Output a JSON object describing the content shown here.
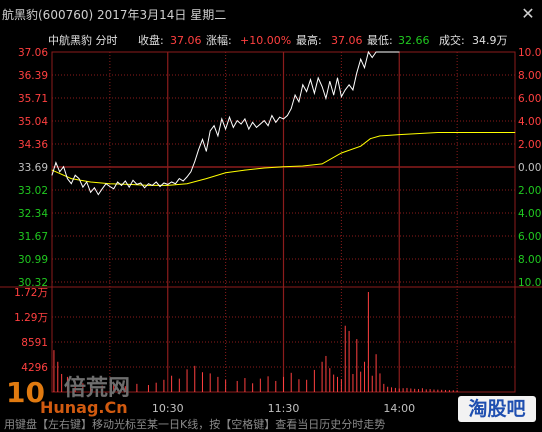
{
  "window": {
    "title": "航黑豹(600760) 2017年3月14日 星期二",
    "close_icon": "close-icon"
  },
  "header": {
    "name": "中航黑豹",
    "mode": "分时",
    "close_label": "收盘:",
    "close_value": "37.06",
    "change_label": "涨幅:",
    "change_value": "+10.00%",
    "high_label": "最高:",
    "high_value": "37.06",
    "low_label": "最低:",
    "low_value": "32.66",
    "volume_label": "成交:",
    "volume_value": "34.9万"
  },
  "colors": {
    "up": "#ff4040",
    "down": "#20c820",
    "avg": "#ffff00",
    "price_line": "#ffffff",
    "grid": "#8c1c1c",
    "volume_bar": "#ff4040",
    "text_gray": "#c0c0c0"
  },
  "chart_data": {
    "type": "line",
    "price_axis": {
      "ticks": [
        "37.06",
        "36.39",
        "35.71",
        "35.04",
        "34.36",
        "33.69",
        "33.02",
        "32.34",
        "31.67",
        "30.99",
        "30.32"
      ],
      "ylim": [
        30.32,
        37.06
      ],
      "prev_close": 33.69
    },
    "pct_axis": {
      "ticks": [
        "10.00",
        "8.00",
        "6.00",
        "4.00",
        "2.00",
        "0.00",
        "2.00",
        "4.00",
        "6.00",
        "8.00",
        "10.0"
      ]
    },
    "x_axis": {
      "labels": [
        "10:30",
        "11:30",
        "14:00"
      ],
      "label_minutes": [
        60,
        120,
        180
      ],
      "total_minutes": 240
    },
    "series": [
      {
        "name": "",
        "minutes": [
          0,
          2,
          4,
          6,
          8,
          10,
          12,
          14,
          16,
          18,
          20,
          22,
          24,
          26,
          28,
          30,
          32,
          34,
          36,
          38,
          40,
          42,
          44,
          46,
          48,
          50,
          52,
          54,
          56,
          58,
          60,
          62,
          64,
          66,
          68,
          70,
          72,
          74,
          76,
          78,
          80,
          82,
          84,
          86,
          88,
          90,
          92,
          94,
          96,
          98,
          100,
          102,
          104,
          106,
          108,
          110,
          112,
          114,
          116,
          118,
          120,
          122,
          124,
          126,
          128,
          130,
          132,
          134,
          136,
          138,
          140,
          142,
          144,
          146,
          148,
          150,
          152,
          154,
          156,
          158,
          160,
          162,
          164,
          166,
          168,
          170,
          172,
          174,
          176,
          178,
          180
        ],
        "values": [
          33.45,
          33.82,
          33.55,
          33.7,
          33.35,
          33.2,
          33.45,
          33.35,
          33.1,
          33.25,
          32.95,
          33.08,
          32.88,
          33.05,
          33.2,
          33.12,
          33.05,
          33.25,
          33.15,
          33.28,
          33.1,
          33.3,
          33.18,
          33.22,
          33.08,
          33.2,
          33.15,
          33.25,
          33.12,
          33.22,
          33.18,
          33.25,
          33.2,
          33.35,
          33.28,
          33.4,
          33.55,
          33.85,
          34.2,
          34.5,
          34.15,
          34.75,
          34.9,
          34.6,
          35.1,
          34.8,
          35.15,
          34.85,
          35.05,
          34.95,
          35.1,
          34.8,
          35.0,
          34.85,
          34.95,
          35.05,
          34.9,
          35.2,
          35.0,
          35.15,
          35.1,
          35.2,
          35.4,
          35.8,
          35.6,
          36.1,
          35.9,
          36.25,
          35.85,
          36.3,
          36.05,
          35.7,
          36.2,
          35.8,
          36.3,
          35.75,
          35.95,
          36.1,
          35.95,
          36.45,
          36.85,
          36.6,
          37.06,
          36.9,
          37.06,
          37.06,
          37.06,
          37.06,
          37.06,
          37.06,
          37.06
        ]
      },
      {
        "name": "",
        "minutes": [
          0,
          10,
          20,
          30,
          40,
          50,
          60,
          70,
          80,
          90,
          100,
          110,
          120,
          130,
          140,
          150,
          160,
          165,
          170,
          180,
          200,
          220,
          240
        ],
        "values": [
          33.6,
          33.35,
          33.25,
          33.2,
          33.18,
          33.15,
          33.15,
          33.2,
          33.35,
          33.52,
          33.6,
          33.66,
          33.7,
          33.72,
          33.78,
          34.1,
          34.3,
          34.52,
          34.6,
          34.64,
          34.7,
          34.7,
          34.7
        ]
      }
    ],
    "volume": {
      "ticks": [
        "1.72万",
        "1.29万",
        "8591",
        "4296"
      ],
      "ymax": 17200,
      "minutes": [
        1,
        3,
        5,
        8,
        12,
        16,
        20,
        26,
        32,
        38,
        44,
        50,
        54,
        58,
        62,
        66,
        70,
        74,
        78,
        82,
        86,
        90,
        96,
        100,
        104,
        108,
        112,
        116,
        120,
        124,
        128,
        132,
        136,
        140,
        142,
        144,
        146,
        148,
        150,
        152,
        154,
        156,
        158,
        160,
        162,
        164,
        166,
        168,
        170,
        172,
        174,
        176,
        178,
        180,
        182,
        184,
        186,
        188,
        190,
        192,
        194,
        196,
        198,
        200,
        202,
        204,
        206,
        208,
        210
      ],
      "values": [
        7200,
        5200,
        3100,
        2600,
        1900,
        1500,
        1200,
        1100,
        1300,
        1000,
        1400,
        1200,
        1600,
        2100,
        2800,
        2300,
        3900,
        4500,
        3400,
        3200,
        2600,
        2100,
        1900,
        2400,
        1500,
        2300,
        2700,
        1900,
        2600,
        3300,
        2200,
        2100,
        3800,
        5200,
        6200,
        4100,
        3000,
        2600,
        2200,
        11400,
        10500,
        3100,
        9100,
        3500,
        5200,
        17200,
        2800,
        6500,
        3200,
        1400,
        900,
        800,
        700,
        600,
        650,
        700,
        600,
        550,
        500,
        650,
        450,
        500,
        420,
        400,
        380,
        350,
        320,
        300,
        280
      ]
    }
  },
  "watermark": {
    "num": "10",
    "cn": "倍荒网",
    "domain": "Hunag.Cn",
    "right": "淘股吧"
  },
  "footer": {
    "text": "用键盘【左右键】移动光标至某一日K线，按【空格键】查看当日历史分时走势"
  }
}
